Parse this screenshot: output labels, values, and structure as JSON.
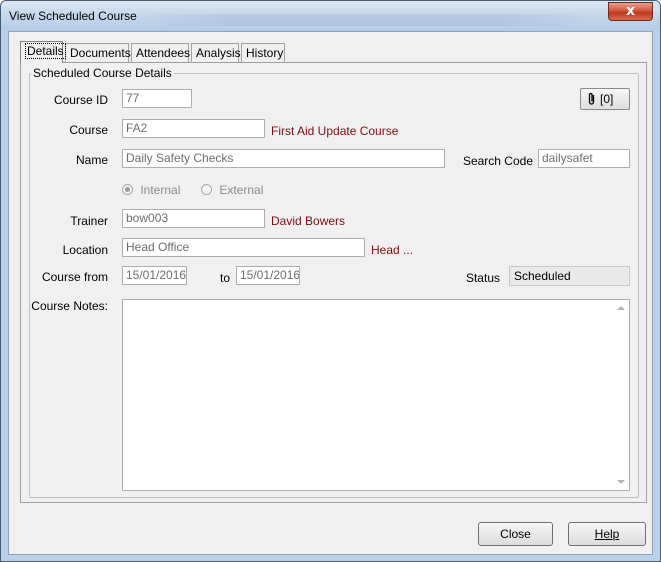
{
  "window": {
    "title": "View Scheduled Course",
    "close_glyph": "x"
  },
  "tabs": [
    {
      "label": "Details",
      "active": true
    },
    {
      "label": "Documents",
      "active": false
    },
    {
      "label": "Attendees",
      "active": false
    },
    {
      "label": "Analysis",
      "active": false
    },
    {
      "label": "History",
      "active": false
    }
  ],
  "group": {
    "title": "Scheduled Course Details"
  },
  "attachments": {
    "count_label": "[0]",
    "icon": "paperclip-icon"
  },
  "fields": {
    "course_id": {
      "label": "Course ID",
      "value": "77"
    },
    "course": {
      "label": "Course",
      "value": "FA2",
      "description": "First Aid Update Course"
    },
    "name": {
      "label": "Name",
      "value": "Daily Safety Checks"
    },
    "search_code": {
      "label": "Search Code",
      "value": "dailysafet"
    },
    "delivery": {
      "internal_label": "Internal",
      "external_label": "External",
      "selected": "Internal"
    },
    "trainer": {
      "label": "Trainer",
      "value": "bow003",
      "description": "David Bowers"
    },
    "location": {
      "label": "Location",
      "value": "Head Office",
      "description": "Head ..."
    },
    "course_from": {
      "label": "Course from",
      "value": "15/01/2016"
    },
    "course_to": {
      "label": "to",
      "value": "15/01/2016"
    },
    "status": {
      "label": "Status",
      "value": "Scheduled"
    },
    "notes": {
      "label": "Course Notes:",
      "value": ""
    }
  },
  "footer": {
    "close_label": "Close",
    "help_label": "Help"
  },
  "colors": {
    "description_text": "#7b0f0f",
    "frame": "#b9d1ea",
    "close_button": "#c0381d"
  }
}
